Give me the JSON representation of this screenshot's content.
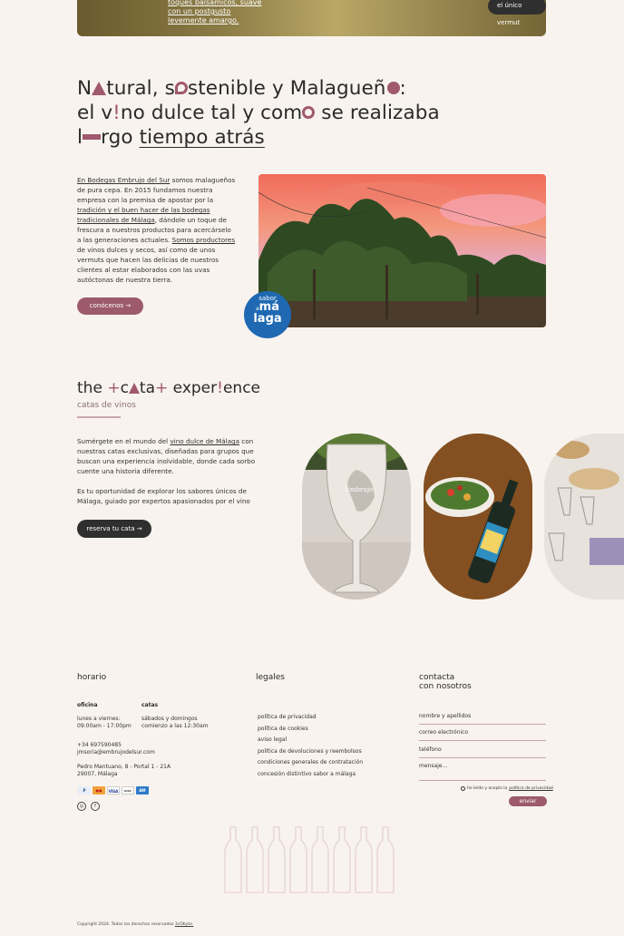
{
  "banner": {
    "text_lines": [
      "toques balsámicos, suave",
      "con un postgusto",
      "levemente amargo."
    ],
    "button": "el único vermut blanco malagueño →"
  },
  "headline": {
    "line1_a": "N",
    "line1_b": "tural, s",
    "line1_c": "stenible y Malagueñ",
    "line1_d": ":",
    "line2_a": "el v",
    "line2_b": "!",
    "line2_c": "no dulce tal y com",
    "line2_d": " se realizaba",
    "line3_a": "l",
    "line3_b": "rgo ",
    "line3_c": "tiempo atrás"
  },
  "intro": {
    "link1": "En Bodegas Embrujo del Sur",
    "text1": " somos malagueños de pura cepa. En 2015 fundamos nuestra empresa con la premisa de apostar por la ",
    "link2": "tradición y el buen hacer de las bodegas tradicionales de Málaga",
    "text2": ", dándole un toque de frescura a nuestros productos para acercárselo a las generaciones actuales. ",
    "link3": "Somos productores",
    "text3": " de vinos dulces y secos, así como de unos vermuts que hacen las delicias de nuestros clientes al estar elaborados con las uvas autóctonas de nuestra tierra.",
    "button": "conócenos →"
  },
  "badge": {
    "line1": "sabor",
    "line2": "a",
    "line3": "má",
    "line4": "laga"
  },
  "catas": {
    "title_a": "the ",
    "title_b": "c",
    "title_c": "ta",
    "title_d": " exper",
    "title_e": "!",
    "title_f": "ence",
    "subtitle": "catas de vinos",
    "p1_a": "Sumérgete en el mundo del ",
    "p1_link": "vino dulce de Málaga",
    "p1_b": " con nuestras catas exclusivas, diseñadas para grupos que buscan una experiencia inolvidable, donde cada sorbo cuente una historia diferente.",
    "p2": "Es tu oportunidad de explorar los sabores únicos de Málaga, guiado por expertos apasionados por el vino",
    "button": "reserva tu cata →"
  },
  "footer": {
    "horario": {
      "title": "horario",
      "oficina_label": "oficina",
      "oficina_l1": "lunes a viernes:",
      "oficina_l2": "09:00am - 17:00pm",
      "catas_label": "catas",
      "catas_l1": "sábados y domingos",
      "catas_l2": "comienzo a las 12:30am",
      "phone": "+34 697590485",
      "email": "jmsoria@embrujodelsur.com",
      "address_l1": "Pedro Mantuano, 8 - Portal 1 - 21A",
      "address_l2": "29007, Málaga"
    },
    "payments": [
      "PayPal",
      "MC",
      "VISA",
      "DISCOVER",
      "AMEX"
    ],
    "social": [
      "instagram-icon",
      "facebook-icon"
    ],
    "legales": {
      "title": "legales",
      "links": [
        "política de privacidad",
        "política de cookies",
        "aviso legal",
        "política de devoluciones y reembolsos",
        "condiciones generales de contratación",
        "concesión distintivo sabor a málaga"
      ]
    },
    "contacta": {
      "title_l1": "contacta",
      "title_l2": "con nosotros",
      "fields": [
        "nombre y apellidos",
        "correo electrónico",
        "teléfono",
        "mensaje..."
      ],
      "consent_a": "he leído y acepto la ",
      "consent_link": "política de privacidad",
      "submit": "enviar"
    },
    "copyright_a": "Copyright 2024. Todos los derechos reservados ",
    "copyright_link": "3cObyte."
  },
  "colors": {
    "accent": "#9c5a6c",
    "dark": "#2f2f2f",
    "background": "#f8f3ee",
    "badge_blue": "#1f69b3"
  }
}
